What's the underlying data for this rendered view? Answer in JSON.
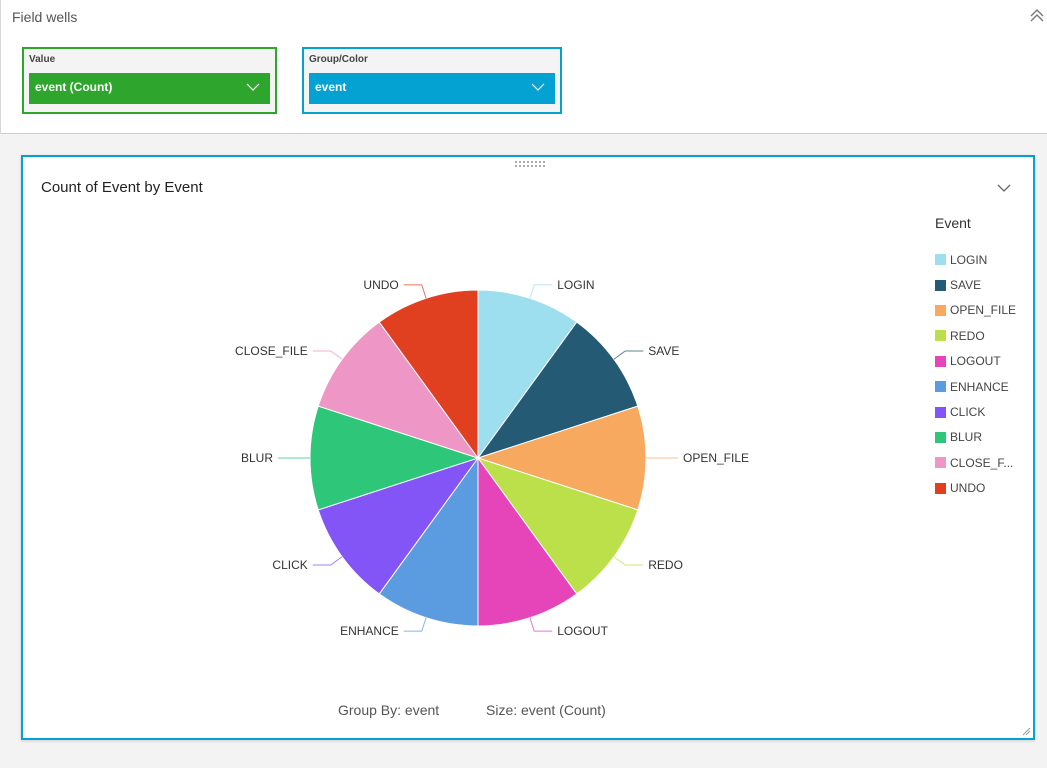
{
  "field_wells": {
    "title": "Field wells",
    "value": {
      "label": "Value",
      "selected": "event (Count)",
      "color": "#2ea62e"
    },
    "group_color": {
      "label": "Group/Color",
      "selected": "event",
      "color": "#04a1d3"
    }
  },
  "visual": {
    "title": "Count of Event by Event",
    "legend_title": "Event",
    "footer": {
      "group_by": "Group By: event",
      "size": "Size: event (Count)"
    }
  },
  "chart_data": {
    "type": "pie",
    "title": "Count of Event by Event",
    "legend_title": "Event",
    "legend_position": "right",
    "value_field": "event (Count)",
    "group_field": "event",
    "categories": [
      "LOGIN",
      "SAVE",
      "OPEN_FILE",
      "REDO",
      "LOGOUT",
      "ENHANCE",
      "CLICK",
      "BLUR",
      "CLOSE_FILE",
      "UNDO"
    ],
    "legend_labels": [
      "LOGIN",
      "SAVE",
      "OPEN_FILE",
      "REDO",
      "LOGOUT",
      "ENHANCE",
      "CLICK",
      "BLUR",
      "CLOSE_F...",
      "UNDO"
    ],
    "values": [
      1,
      1,
      1,
      1,
      1,
      1,
      1,
      1,
      1,
      1
    ],
    "colors": [
      "#9ddeef",
      "#245a74",
      "#f7a960",
      "#bce04a",
      "#e545b8",
      "#5b9be0",
      "#8355f7",
      "#2ec77a",
      "#ee96c6",
      "#e04020"
    ]
  }
}
